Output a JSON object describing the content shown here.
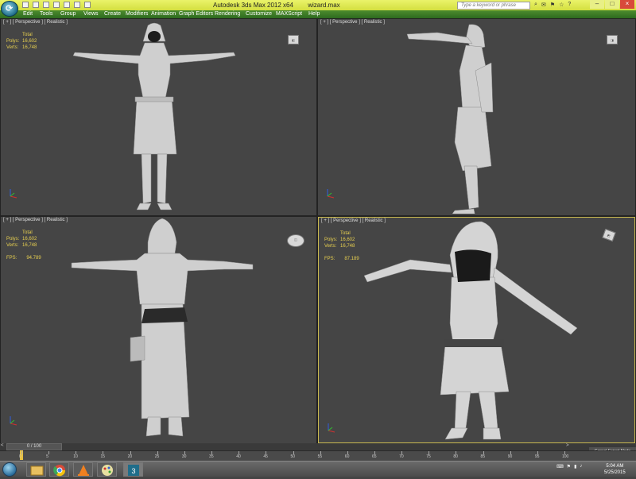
{
  "titlebar": {
    "app_title": "Autodesk 3ds Max  2012 x64",
    "file_name": "wizard.max",
    "search_placeholder": "Type a keyword or phrase"
  },
  "menu": {
    "items": [
      "Edit",
      "Tools",
      "Group",
      "Views",
      "Create",
      "Modifiers",
      "Animation",
      "Graph Editors",
      "Rendering",
      "Customize",
      "MAXScript",
      "Help"
    ]
  },
  "viewports": [
    {
      "label": "[ + ] [ Perspective ] [ Realistic ]",
      "stats": {
        "total": "Total",
        "polys_label": "Polys:",
        "polys": "16,602",
        "verts_label": "Verts:",
        "verts": "16,748"
      }
    },
    {
      "label": "[ + ] [ Perspective ] [ Realistic ]"
    },
    {
      "label": "[ + ] [ Perspective ] [ Realistic ]",
      "stats": {
        "total": "Total",
        "polys_label": "Polys:",
        "polys": "16,602",
        "verts_label": "Verts:",
        "verts": "16,748"
      },
      "fps_label": "FPS:",
      "fps": "94.789"
    },
    {
      "label": "[ + ] [ Perspective ] [ Realistic ]",
      "stats": {
        "total": "Total",
        "polys_label": "Polys:",
        "polys": "16,602",
        "verts_label": "Verts:",
        "verts": "16,748"
      },
      "fps_label": "FPS:",
      "fps": "87.189"
    }
  ],
  "timeline": {
    "slider_label": "0 / 100",
    "left_arrow": "<",
    "right_arrow": ">",
    "ticks": [
      "0",
      "5",
      "10",
      "15",
      "20",
      "25",
      "30",
      "35",
      "40",
      "45",
      "50",
      "55",
      "60",
      "65",
      "70",
      "75",
      "80",
      "85",
      "90",
      "95",
      "100"
    ]
  },
  "expert_mode": {
    "label": "Cancel Expert Mode"
  },
  "taskbar": {
    "apps": [
      "file-explorer",
      "chrome",
      "vlc",
      "paint",
      "3ds-max"
    ],
    "time": "5:04 AM",
    "date": "5/25/2015"
  },
  "colors": {
    "titlebar": "#d8e24a",
    "menubar": "#3a7a26",
    "viewport_bg": "#454545",
    "stats_text": "#e8d050",
    "active_border": "#c8b850"
  }
}
